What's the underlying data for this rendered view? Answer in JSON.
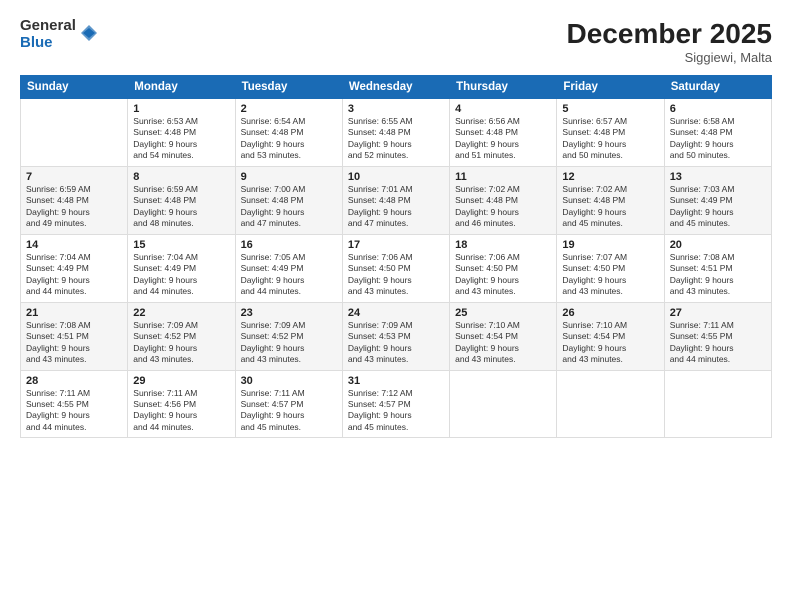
{
  "logo": {
    "general": "General",
    "blue": "Blue"
  },
  "header": {
    "title": "December 2025",
    "location": "Siggiewi, Malta"
  },
  "weekdays": [
    "Sunday",
    "Monday",
    "Tuesday",
    "Wednesday",
    "Thursday",
    "Friday",
    "Saturday"
  ],
  "weeks": [
    [
      {
        "day": "",
        "info": ""
      },
      {
        "day": "1",
        "info": "Sunrise: 6:53 AM\nSunset: 4:48 PM\nDaylight: 9 hours\nand 54 minutes."
      },
      {
        "day": "2",
        "info": "Sunrise: 6:54 AM\nSunset: 4:48 PM\nDaylight: 9 hours\nand 53 minutes."
      },
      {
        "day": "3",
        "info": "Sunrise: 6:55 AM\nSunset: 4:48 PM\nDaylight: 9 hours\nand 52 minutes."
      },
      {
        "day": "4",
        "info": "Sunrise: 6:56 AM\nSunset: 4:48 PM\nDaylight: 9 hours\nand 51 minutes."
      },
      {
        "day": "5",
        "info": "Sunrise: 6:57 AM\nSunset: 4:48 PM\nDaylight: 9 hours\nand 50 minutes."
      },
      {
        "day": "6",
        "info": "Sunrise: 6:58 AM\nSunset: 4:48 PM\nDaylight: 9 hours\nand 50 minutes."
      }
    ],
    [
      {
        "day": "7",
        "info": "Sunrise: 6:59 AM\nSunset: 4:48 PM\nDaylight: 9 hours\nand 49 minutes."
      },
      {
        "day": "8",
        "info": "Sunrise: 6:59 AM\nSunset: 4:48 PM\nDaylight: 9 hours\nand 48 minutes."
      },
      {
        "day": "9",
        "info": "Sunrise: 7:00 AM\nSunset: 4:48 PM\nDaylight: 9 hours\nand 47 minutes."
      },
      {
        "day": "10",
        "info": "Sunrise: 7:01 AM\nSunset: 4:48 PM\nDaylight: 9 hours\nand 47 minutes."
      },
      {
        "day": "11",
        "info": "Sunrise: 7:02 AM\nSunset: 4:48 PM\nDaylight: 9 hours\nand 46 minutes."
      },
      {
        "day": "12",
        "info": "Sunrise: 7:02 AM\nSunset: 4:48 PM\nDaylight: 9 hours\nand 45 minutes."
      },
      {
        "day": "13",
        "info": "Sunrise: 7:03 AM\nSunset: 4:49 PM\nDaylight: 9 hours\nand 45 minutes."
      }
    ],
    [
      {
        "day": "14",
        "info": "Sunrise: 7:04 AM\nSunset: 4:49 PM\nDaylight: 9 hours\nand 44 minutes."
      },
      {
        "day": "15",
        "info": "Sunrise: 7:04 AM\nSunset: 4:49 PM\nDaylight: 9 hours\nand 44 minutes."
      },
      {
        "day": "16",
        "info": "Sunrise: 7:05 AM\nSunset: 4:49 PM\nDaylight: 9 hours\nand 44 minutes."
      },
      {
        "day": "17",
        "info": "Sunrise: 7:06 AM\nSunset: 4:50 PM\nDaylight: 9 hours\nand 43 minutes."
      },
      {
        "day": "18",
        "info": "Sunrise: 7:06 AM\nSunset: 4:50 PM\nDaylight: 9 hours\nand 43 minutes."
      },
      {
        "day": "19",
        "info": "Sunrise: 7:07 AM\nSunset: 4:50 PM\nDaylight: 9 hours\nand 43 minutes."
      },
      {
        "day": "20",
        "info": "Sunrise: 7:08 AM\nSunset: 4:51 PM\nDaylight: 9 hours\nand 43 minutes."
      }
    ],
    [
      {
        "day": "21",
        "info": "Sunrise: 7:08 AM\nSunset: 4:51 PM\nDaylight: 9 hours\nand 43 minutes."
      },
      {
        "day": "22",
        "info": "Sunrise: 7:09 AM\nSunset: 4:52 PM\nDaylight: 9 hours\nand 43 minutes."
      },
      {
        "day": "23",
        "info": "Sunrise: 7:09 AM\nSunset: 4:52 PM\nDaylight: 9 hours\nand 43 minutes."
      },
      {
        "day": "24",
        "info": "Sunrise: 7:09 AM\nSunset: 4:53 PM\nDaylight: 9 hours\nand 43 minutes."
      },
      {
        "day": "25",
        "info": "Sunrise: 7:10 AM\nSunset: 4:54 PM\nDaylight: 9 hours\nand 43 minutes."
      },
      {
        "day": "26",
        "info": "Sunrise: 7:10 AM\nSunset: 4:54 PM\nDaylight: 9 hours\nand 43 minutes."
      },
      {
        "day": "27",
        "info": "Sunrise: 7:11 AM\nSunset: 4:55 PM\nDaylight: 9 hours\nand 44 minutes."
      }
    ],
    [
      {
        "day": "28",
        "info": "Sunrise: 7:11 AM\nSunset: 4:55 PM\nDaylight: 9 hours\nand 44 minutes."
      },
      {
        "day": "29",
        "info": "Sunrise: 7:11 AM\nSunset: 4:56 PM\nDaylight: 9 hours\nand 44 minutes."
      },
      {
        "day": "30",
        "info": "Sunrise: 7:11 AM\nSunset: 4:57 PM\nDaylight: 9 hours\nand 45 minutes."
      },
      {
        "day": "31",
        "info": "Sunrise: 7:12 AM\nSunset: 4:57 PM\nDaylight: 9 hours\nand 45 minutes."
      },
      {
        "day": "",
        "info": ""
      },
      {
        "day": "",
        "info": ""
      },
      {
        "day": "",
        "info": ""
      }
    ]
  ]
}
